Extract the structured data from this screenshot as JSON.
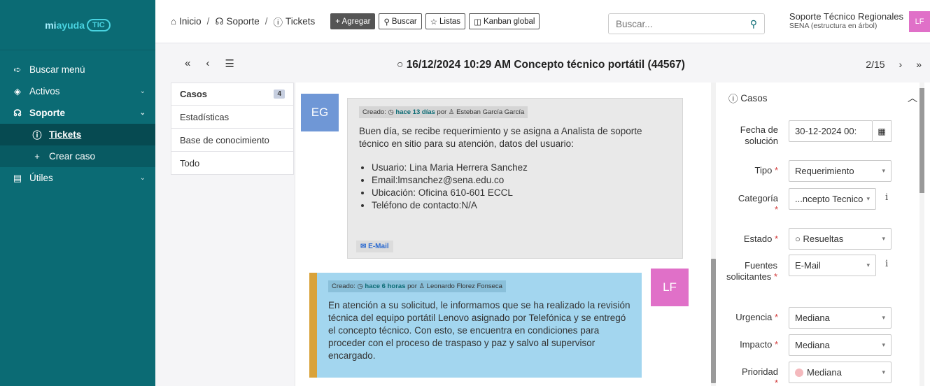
{
  "sidebar": {
    "logo_part1": "mi",
    "logo_part2": "ayuda",
    "logo_part3": "TIC",
    "items": [
      {
        "label": "Buscar menú"
      },
      {
        "label": "Activos"
      },
      {
        "label": "Soporte"
      },
      {
        "label": "Tickets"
      },
      {
        "label": "Crear caso"
      },
      {
        "label": "Útiles"
      }
    ]
  },
  "header": {
    "breadcrumb": [
      "Inicio",
      "Soporte",
      "Tickets"
    ],
    "buttons": [
      "+ Agregar",
      "Buscar",
      "Listas",
      "Kanban global"
    ],
    "search_placeholder": "Buscar...",
    "user_name": "Soporte Técnico Regionales",
    "user_sub": "SENA (estructura en árbol)",
    "user_initials": "LF"
  },
  "ticket": {
    "title": "16/12/2024 10:29 AM Concepto técnico portátil (44567)",
    "position": "2/15"
  },
  "tabs": [
    {
      "label": "Casos",
      "count": "4"
    },
    {
      "label": "Estadísticas"
    },
    {
      "label": "Base de conocimiento"
    },
    {
      "label": "Todo"
    }
  ],
  "timeline": {
    "msg1": {
      "initials": "EG",
      "created_label": "Creado:",
      "time": "hace 13 días",
      "by": "por",
      "author": "Esteban García García",
      "text": "Buen día, se recibe requerimiento y se asigna a Analista de soporte técnico en sitio para su atención, datos del usuario:",
      "list": [
        "Usuario: Lina Maria Herrera Sanchez",
        "Email:lmsanchez@sena.edu.co",
        "Ubicación: Oficina 610-601 ECCL",
        "Teléfono de contacto:N/A"
      ],
      "source": "E-Mail"
    },
    "msg2": {
      "initials": "LF",
      "created_label": "Creado:",
      "time": "hace 6 horas",
      "by": "por",
      "author": "Leonardo Florez Fonseca",
      "text": "En atención a su solicitud, le informamos que se ha realizado la revisión técnica del equipo portátil Lenovo asignado por Telefónica y se entregó el concepto técnico. Con esto, se encuentra en condiciones para proceder con el proceso de traspaso y paz y salvo al supervisor encargado."
    }
  },
  "panel": {
    "title": "Casos",
    "fields": {
      "fecha_label": "Fecha de solución",
      "fecha_value": "30-12-2024 00:",
      "tipo_label": "Tipo",
      "tipo_value": "Requerimiento",
      "categoria_label": "Categoría",
      "categoria_value": "...ncepto Tecnico",
      "estado_label": "Estado",
      "estado_value": "Resueltas",
      "fuentes_label": "Fuentes solicitantes",
      "fuentes_value": "E-Mail",
      "urgencia_label": "Urgencia",
      "urgencia_value": "Mediana",
      "impacto_label": "Impacto",
      "impacto_value": "Mediana",
      "prioridad_label": "Prioridad",
      "prioridad_value": "Mediana"
    }
  },
  "colors": {
    "sidebar": "#0b6b74",
    "msg2_bg": "#a3d6ef",
    "msg2_accent": "#d9a23a",
    "avatar_eg": "#6f97d6",
    "avatar_lf": "#e070c8",
    "prioridad_dot": "#f4b9bd"
  }
}
